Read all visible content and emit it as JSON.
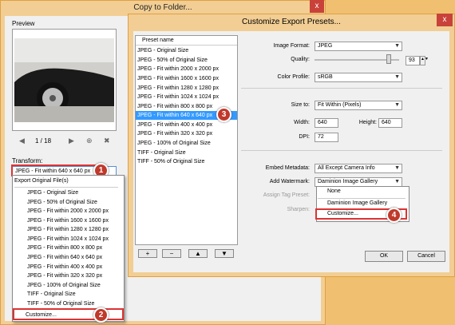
{
  "back_window": {
    "title": "Copy to Folder...",
    "close": "x",
    "preview_label": "Preview",
    "pager": "1 / 18",
    "transform_label": "Transform:",
    "transform_value": "JPEG - Fit within 640 x 640 px",
    "dropdown_items": [
      "Export Original File(s)",
      "JPEG - Original Size",
      "JPEG - 50% of Original Size",
      "JPEG - Fit within 2000 x 2000 px",
      "JPEG - Fit within 1600 x 1600 px",
      "JPEG - Fit within 1280 x 1280 px",
      "JPEG - Fit within 1024 x 1024 px",
      "JPEG - Fit within 800 x 800 px",
      "JPEG - Fit within 640 x 640 px",
      "JPEG - Fit within 400 x 400 px",
      "JPEG - Fit within 320 x 320 px",
      "JPEG - 100% of Original Size",
      "TIFF - Original Size",
      "TIFF - 50% of Original Size",
      "Customize..."
    ]
  },
  "dialog": {
    "title": "Customize Export Presets...",
    "close": "x",
    "preset_header": "Preset name",
    "presets": [
      "JPEG - Original Size",
      "JPEG - 50% of Original Size",
      "JPEG - Fit within 2000 x 2000 px",
      "JPEG - Fit within 1600 x 1600 px",
      "JPEG - Fit within 1280 x 1280 px",
      "JPEG - Fit within 1024 x 1024 px",
      "JPEG - Fit within 800 x 800 px",
      "JPEG - Fit within 640 x 640 px",
      "JPEG - Fit within 400 x 400 px",
      "JPEG - Fit within 320 x 320 px",
      "JPEG - 100% of Original Size",
      "TIFF - Original Size",
      "TIFF - 50% of Original Size"
    ],
    "selected_preset_index": 7,
    "list_buttons": [
      "+",
      "−",
      "▲",
      "▼"
    ],
    "image_format_label": "Image Format:",
    "image_format_value": "JPEG",
    "quality_label": "Quality:",
    "quality_value": "93",
    "color_profile_label": "Color Profile:",
    "color_profile_value": "sRGB",
    "size_to_label": "Size to:",
    "size_to_value": "Fit Within (Pixels)",
    "width_label": "Width:",
    "width_value": "640",
    "height_label": "Height:",
    "height_value": "640",
    "dpi_label": "DPI:",
    "dpi_value": "72",
    "embed_metadata_label": "Embed Metadata:",
    "embed_metadata_value": "All Except Camera Info",
    "add_watermark_label": "Add Watermark:",
    "add_watermark_value": "Daminion Image Gallery",
    "assign_tag_label": "Assign Tag Preset:",
    "sharpen_label": "Sharpen:",
    "watermark_options": [
      "None",
      "Daminion Image Gallery",
      "Customize..."
    ],
    "ok_label": "OK",
    "cancel_label": "Cancel"
  },
  "badges": [
    "1",
    "2",
    "3",
    "4"
  ],
  "colors": {
    "badge": "#c0392b",
    "selection": "#3399ff",
    "highlight_box": "#dd3333"
  }
}
